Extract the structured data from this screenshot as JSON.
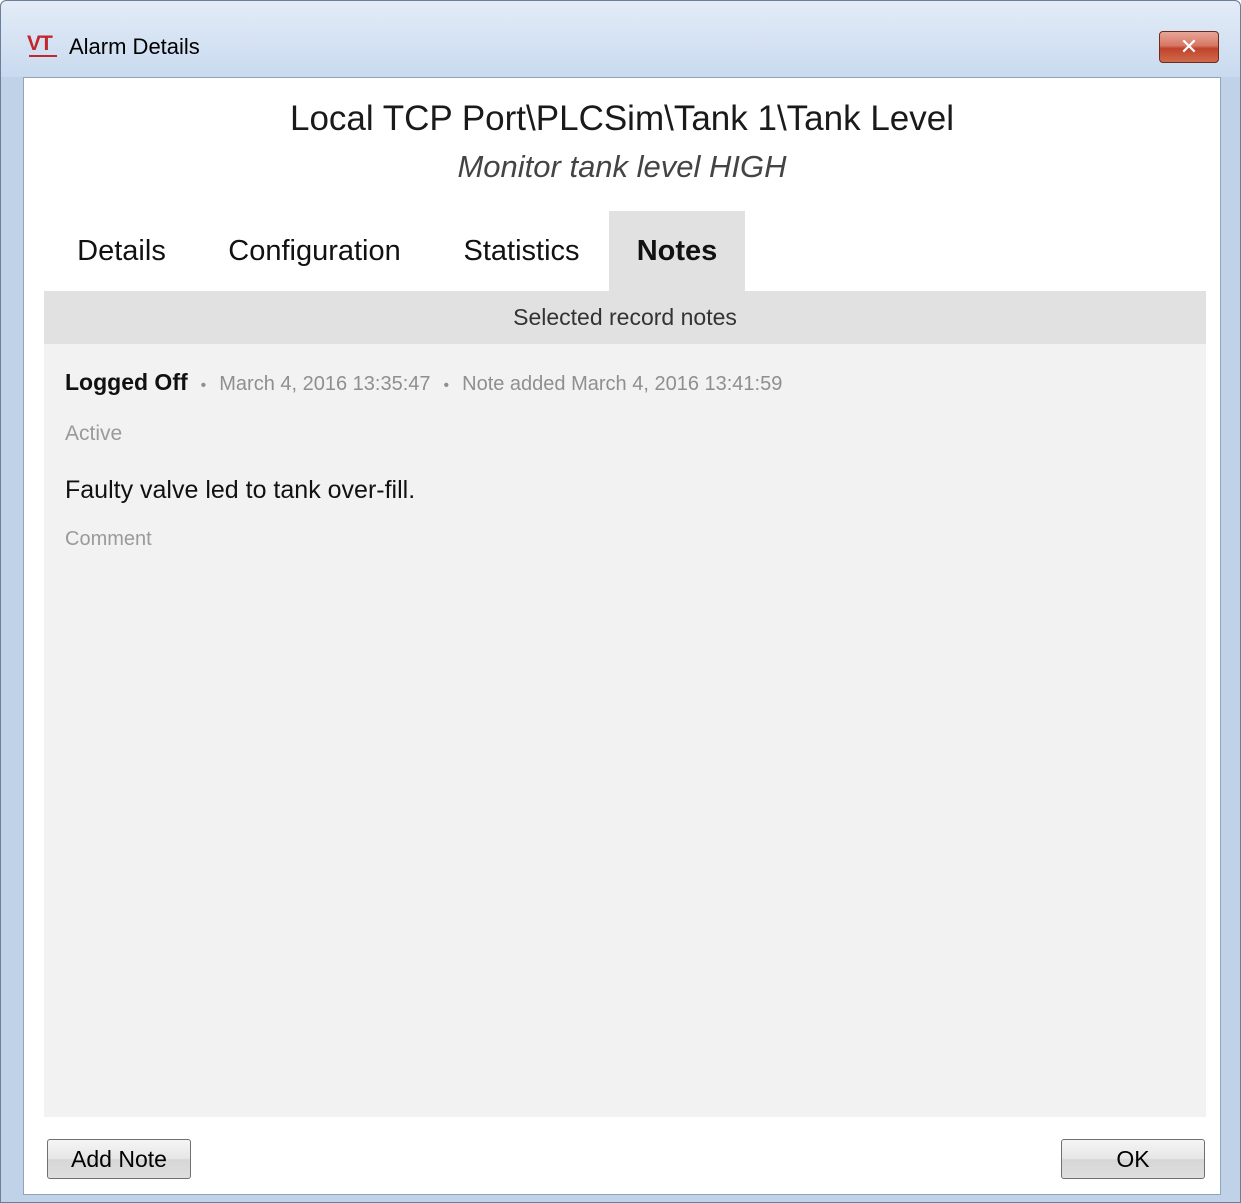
{
  "window": {
    "title": "Alarm Details",
    "logo_text": "VT",
    "close_glyph": "✕"
  },
  "header": {
    "title": "Local TCP Port\\PLCSim\\Tank 1\\Tank Level",
    "subtitle": "Monitor tank level HIGH"
  },
  "tabs": [
    {
      "label": "Details",
      "active": false
    },
    {
      "label": "Configuration",
      "active": false
    },
    {
      "label": "Statistics",
      "active": false
    },
    {
      "label": "Notes",
      "active": true
    }
  ],
  "notes_panel": {
    "section_title": "Selected record notes",
    "notes": [
      {
        "user": "Logged Off",
        "separator": "•",
        "record_time": "March 4, 2016 13:35:47",
        "added_time": "Note added March 4, 2016 13:41:59",
        "state": "Active",
        "text": "Faulty valve led to tank over-fill.",
        "kind": "Comment"
      }
    ]
  },
  "footer": {
    "add_note_label": "Add Note",
    "ok_label": "OK"
  },
  "colors": {
    "logo_red": "#c0282d",
    "close_red": "#c1432b",
    "active_tab_bg": "#e1e1e1",
    "panel_bg": "#f2f2f2"
  }
}
